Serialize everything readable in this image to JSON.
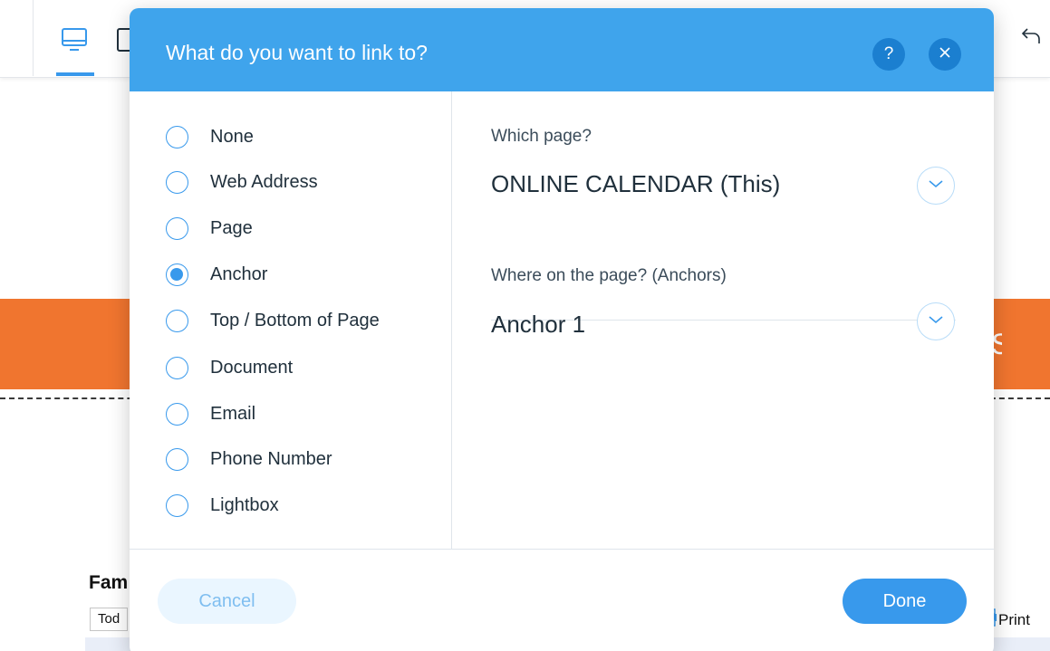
{
  "editor": {
    "calendar_title": "Fam",
    "today_label": "Tod",
    "print_label": "Print",
    "banner_edge_text": "S"
  },
  "dialog": {
    "title": "What do you want to link to?",
    "help_label": "?",
    "link_types": [
      {
        "label": "None",
        "selected": false
      },
      {
        "label": "Web Address",
        "selected": false
      },
      {
        "label": "Page",
        "selected": false
      },
      {
        "label": "Anchor",
        "selected": true
      },
      {
        "label": "Top / Bottom of Page",
        "selected": false
      },
      {
        "label": "Document",
        "selected": false
      },
      {
        "label": "Email",
        "selected": false
      },
      {
        "label": "Phone Number",
        "selected": false
      },
      {
        "label": "Lightbox",
        "selected": false
      }
    ],
    "page_field": {
      "label": "Which page?",
      "value": "ONLINE CALENDAR (This)"
    },
    "anchor_field": {
      "label": "Where on the page? (Anchors)",
      "value": "Anchor 1"
    },
    "cancel_label": "Cancel",
    "done_label": "Done"
  },
  "colors": {
    "accent": "#3899ec",
    "header": "#3fa4ec",
    "banner": "#f0752f"
  },
  "icons": [
    "desktop-icon",
    "tablet-icon",
    "undo-icon",
    "help-icon",
    "close-icon",
    "chevron-down-icon",
    "print-icon"
  ]
}
